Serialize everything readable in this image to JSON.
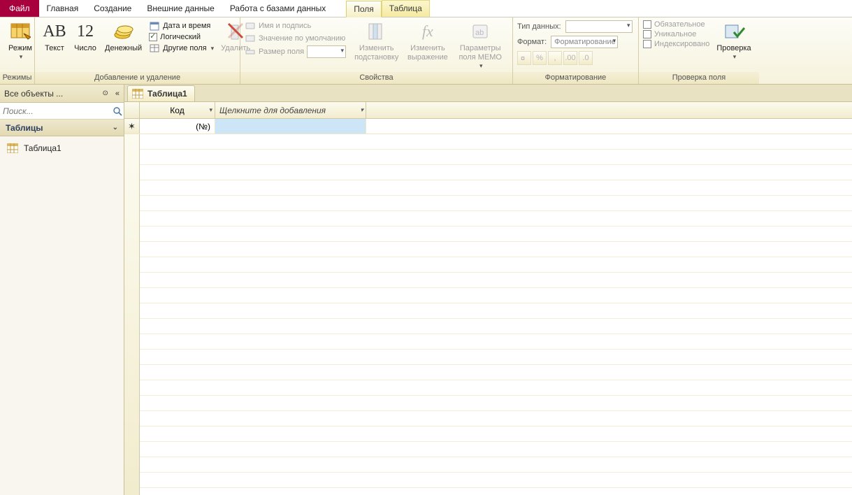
{
  "tabs": {
    "file": "Файл",
    "home": "Главная",
    "create": "Создание",
    "external": "Внешние данные",
    "dbtools": "Работа с базами данных",
    "fields": "Поля",
    "table": "Таблица"
  },
  "ribbon": {
    "modes": {
      "view": "Режим",
      "group": "Режимы"
    },
    "addremove": {
      "text": "Текст",
      "number": "Число",
      "currency": "Денежный",
      "datetime": "Дата и время",
      "boolean": "Логический",
      "morefields": "Другие поля",
      "delete": "Удалить",
      "group": "Добавление и удаление"
    },
    "properties": {
      "namecaption": "Имя и подпись",
      "defaultvalue": "Значение по умолчанию",
      "fieldsize": "Размер поля",
      "modifysub": "Изменить подстановку",
      "modifyexpr": "Изменить выражение",
      "memoparams": "Параметры поля MEMO",
      "group": "Свойства"
    },
    "formatting": {
      "datatype_label": "Тип данных:",
      "format_label": "Формат:",
      "formatting_combo": "Форматирование",
      "group": "Форматирование"
    },
    "validation": {
      "required": "Обязательное",
      "unique": "Уникальное",
      "indexed": "Индексировано",
      "validate": "Проверка",
      "group": "Проверка поля"
    }
  },
  "nav": {
    "header": "Все объекты ...",
    "search_placeholder": "Поиск...",
    "category": "Таблицы",
    "items": [
      "Таблица1"
    ]
  },
  "doc": {
    "tab": "Таблица1",
    "col_id": "Код",
    "col_add": "Щелкните для добавления",
    "row0_id": "(№)"
  }
}
